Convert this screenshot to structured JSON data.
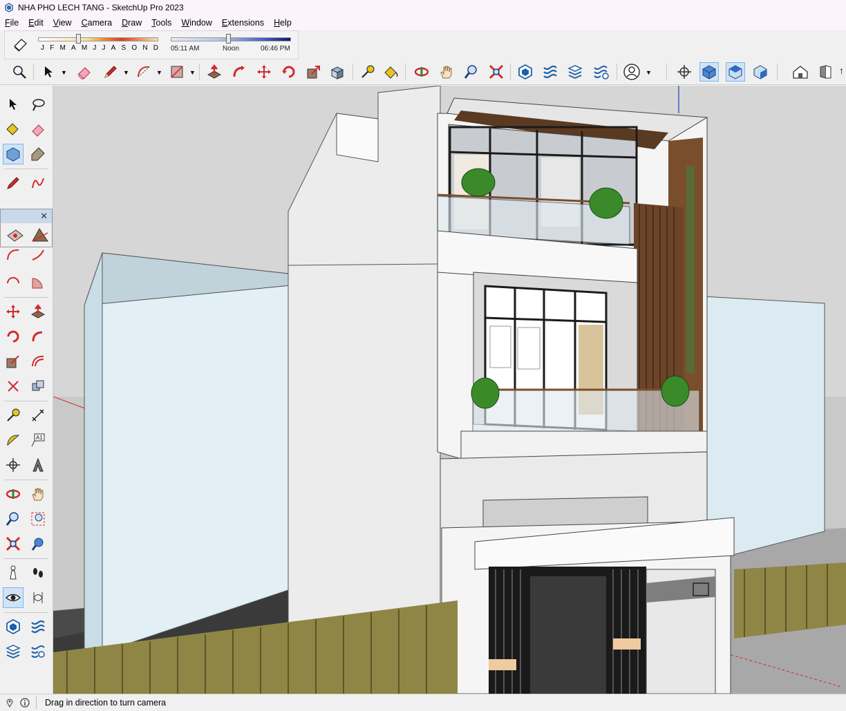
{
  "window": {
    "title": "NHA PHO LECH TANG - SketchUp Pro 2023"
  },
  "menu": [
    {
      "label": "File",
      "key": "F",
      "rest": "ile"
    },
    {
      "label": "Edit",
      "key": "E",
      "rest": "dit"
    },
    {
      "label": "View",
      "key": "V",
      "rest": "iew"
    },
    {
      "label": "Camera",
      "key": "C",
      "rest": "amera"
    },
    {
      "label": "Draw",
      "key": "D",
      "rest": "raw"
    },
    {
      "label": "Tools",
      "key": "T",
      "rest": "ools"
    },
    {
      "label": "Window",
      "key": "W",
      "rest": "indow"
    },
    {
      "label": "Extensions",
      "key": "E",
      "rest": "xtensions"
    },
    {
      "label": "Help",
      "key": "H",
      "rest": "elp"
    }
  ],
  "shadows": {
    "months": [
      "J",
      "F",
      "M",
      "A",
      "M",
      "J",
      "J",
      "A",
      "S",
      "O",
      "N",
      "D"
    ],
    "time_start": "05:11 AM",
    "time_mid": "Noon",
    "time_end": "06:46 PM",
    "date_level": 0.33,
    "time_level": 0.58
  },
  "status": {
    "hint": "Drag in direction to turn camera"
  },
  "colors": {
    "accent": "#7eb4ea",
    "active_bg": "#cfe3f7"
  },
  "toolbar_icons": [
    "zoom-extents-icon",
    "select-icon",
    "eraser-icon",
    "pencil-icon",
    "arc-icon",
    "rectangle-icon",
    "push-pull-icon",
    "follow-me-icon",
    "move-icon",
    "rotate-icon",
    "scale-icon",
    "offset-icon",
    "tape-measure-icon",
    "paint-bucket-icon",
    "orbit-icon",
    "pan-icon",
    "zoom-icon",
    "zoom-window-icon",
    "warehouse-icon",
    "extension-warehouse-icon",
    "layout-icon",
    "extension-manager-icon",
    "account-icon",
    "axes-icon",
    "iso-view-icon",
    "top-view-icon",
    "front-view-icon",
    "home-icon",
    "section-icon"
  ]
}
